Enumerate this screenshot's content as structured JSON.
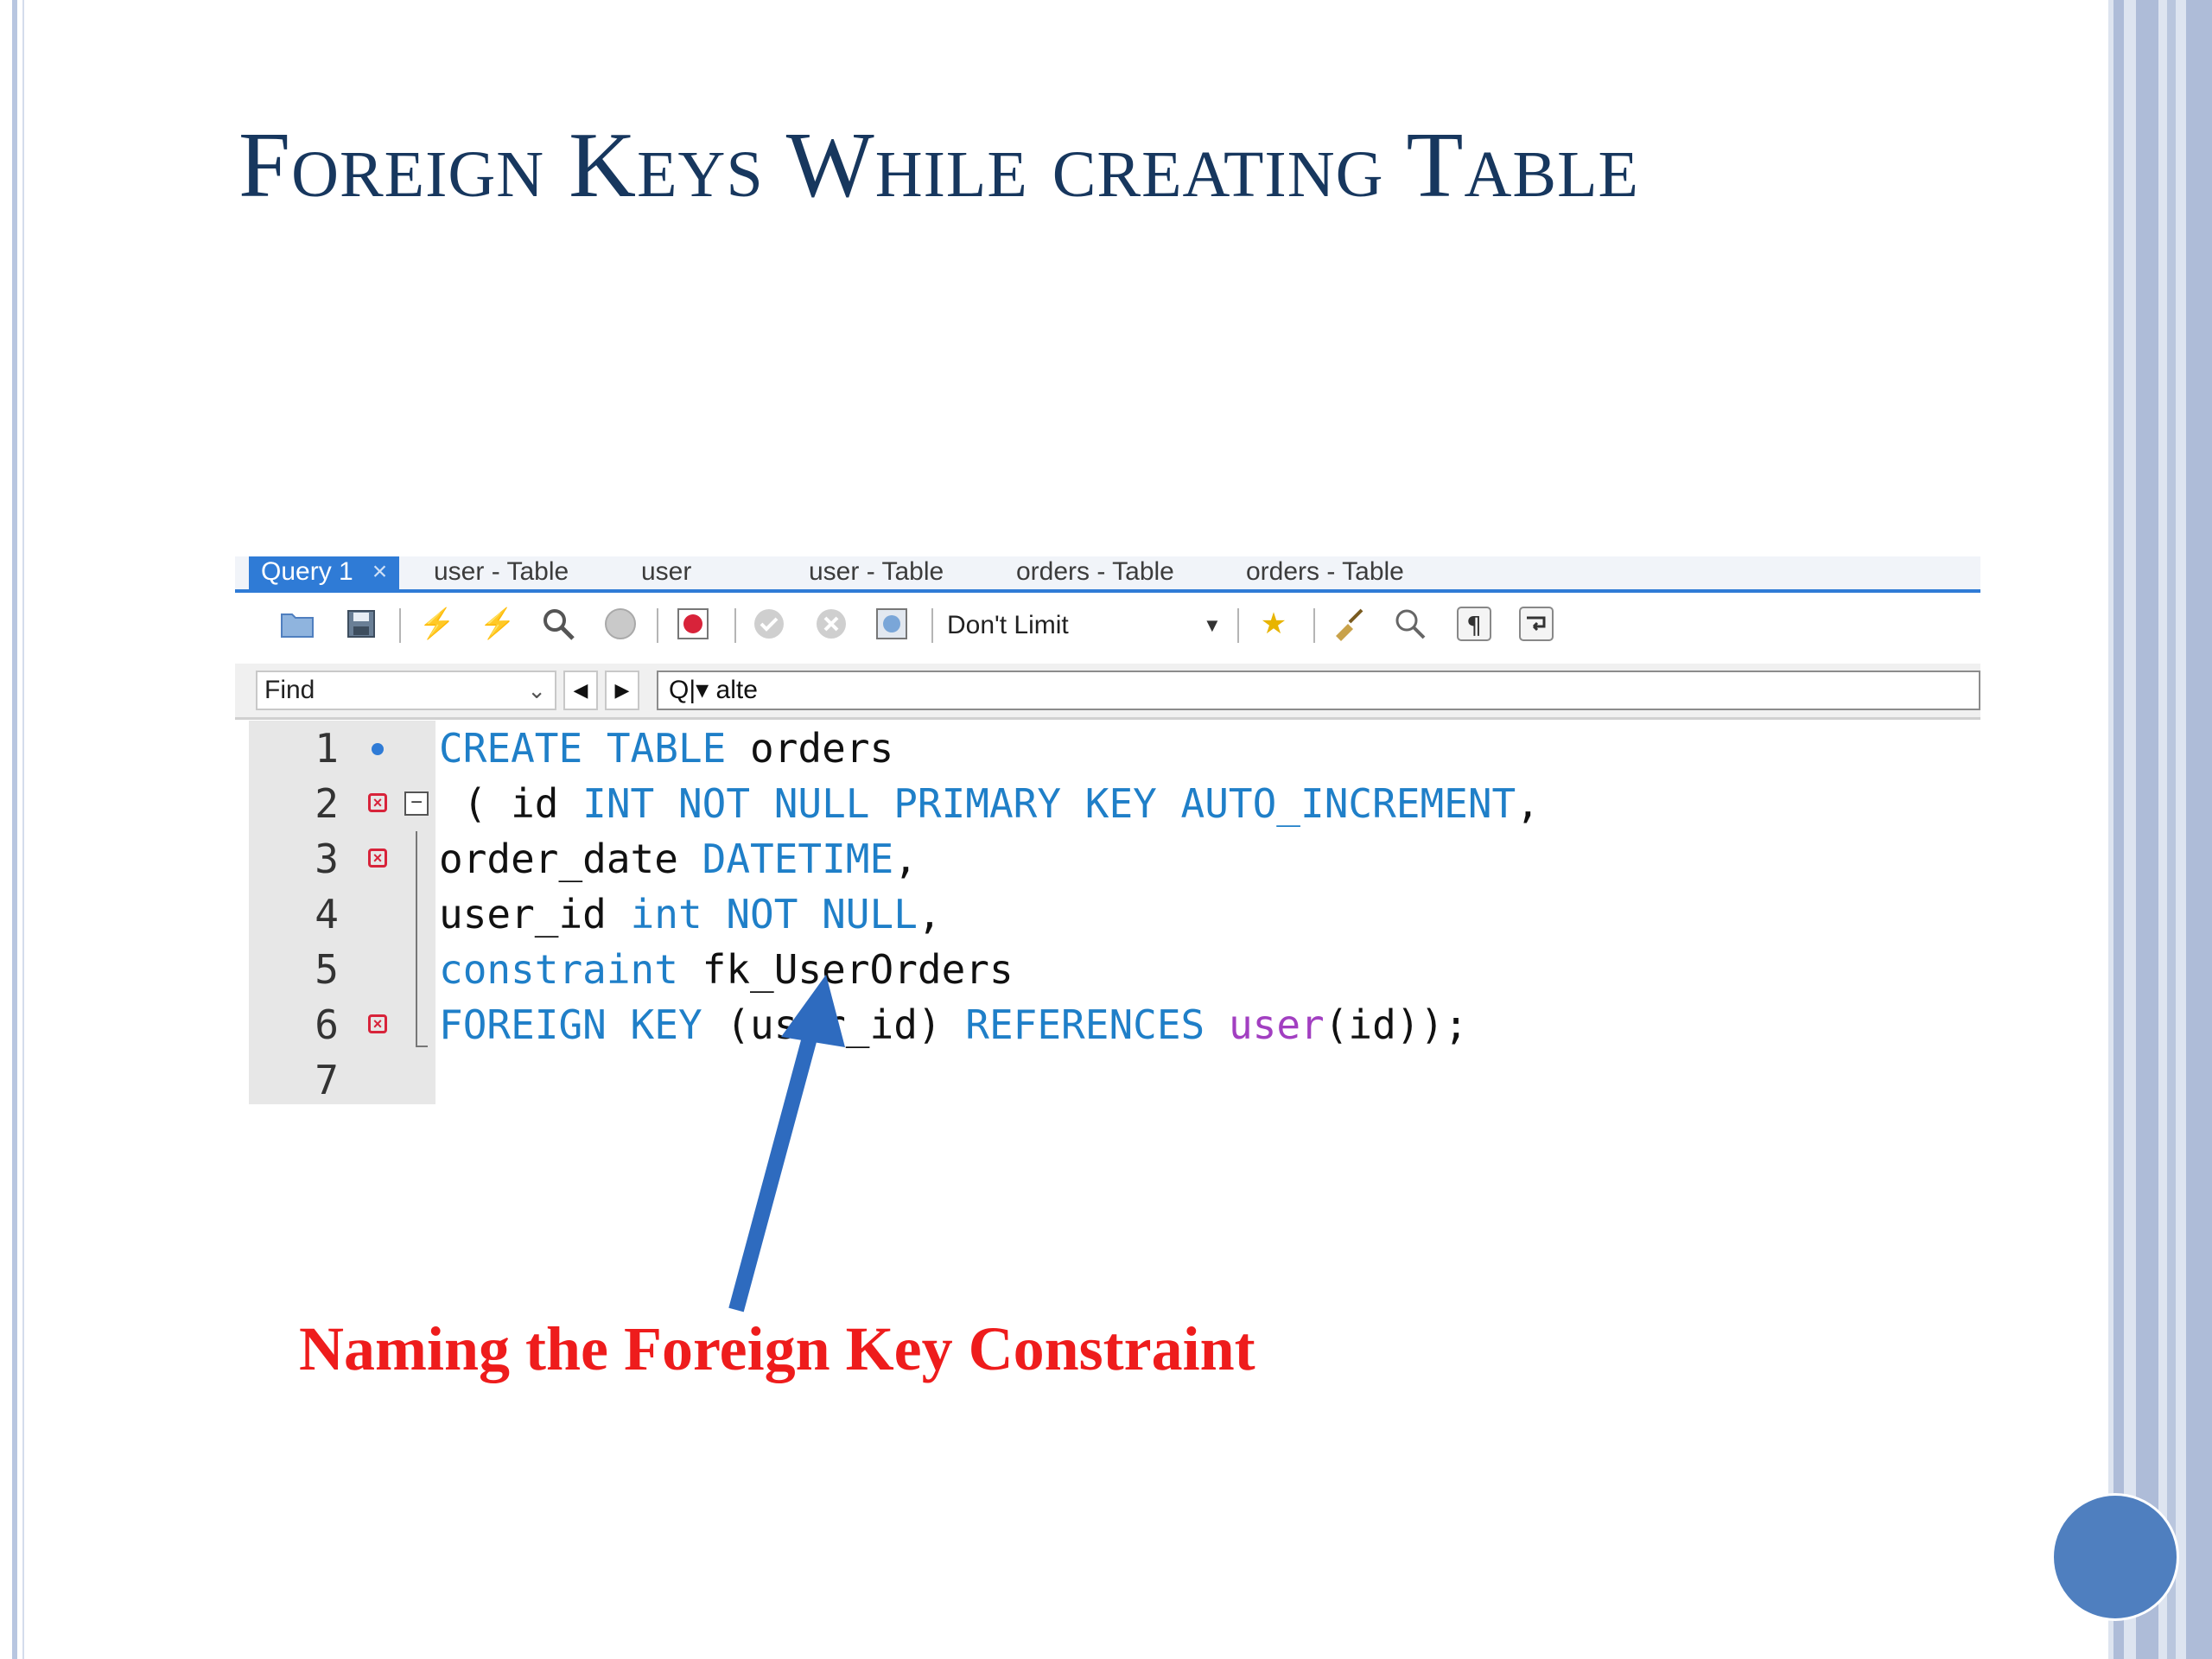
{
  "slide": {
    "title": "Foreign Keys While creating Table",
    "caption": "Naming the Foreign Key Constraint"
  },
  "editor": {
    "tabs": [
      {
        "label": "Query 1",
        "active": true,
        "close": "×"
      },
      {
        "label": "user - Table"
      },
      {
        "label": "user"
      },
      {
        "label": "user - Table"
      },
      {
        "label": "orders - Table"
      },
      {
        "label": "orders - Table"
      }
    ],
    "toolbar": {
      "limit_label": "Don't Limit",
      "icons": [
        "open-folder-icon",
        "save-icon",
        "execute-icon",
        "execute-current-icon",
        "explain-icon",
        "stop-icon",
        "toggle-error-icon",
        "commit-icon",
        "rollback-icon",
        "autocommit-icon",
        "bookmark-icon",
        "beautify-icon",
        "find-icon",
        "invisible-chars-icon",
        "word-wrap-icon"
      ]
    },
    "find": {
      "mode": "Find",
      "search_text": "alte",
      "search_prefix": "Q|▾"
    },
    "lines": [
      {
        "num": "1",
        "marker": "dot"
      },
      {
        "num": "2",
        "marker": "error"
      },
      {
        "num": "3",
        "marker": "error"
      },
      {
        "num": "4",
        "marker": ""
      },
      {
        "num": "5",
        "marker": ""
      },
      {
        "num": "6",
        "marker": "error"
      },
      {
        "num": "7",
        "marker": ""
      }
    ],
    "code": {
      "l1_kw": "CREATE TABLE",
      "l1_rest": " orders",
      "l2_a": " ( id ",
      "l2_kw": "INT NOT NULL PRIMARY KEY AUTO_INCREMENT",
      "l2_b": ",",
      "l3_a": "order_date ",
      "l3_kw": "DATETIME",
      "l3_b": ",",
      "l4_a": "user_id ",
      "l4_kw": "int NOT NULL",
      "l4_b": ",",
      "l5_kw": "constraint",
      "l5_b": " fk_UserOrders",
      "l6_kw1": "FOREIGN KEY",
      "l6_a": " (user_id) ",
      "l6_kw2": "REFERENCES",
      "l6_sp": " ",
      "l6_fn": "user",
      "l6_b": "(id));"
    }
  },
  "colors": {
    "title": "#17375e",
    "caption": "#ee1c1c",
    "keyword": "#1f7fc8",
    "function": "#a23fc1",
    "arrow": "#2e6bbf",
    "accent_circle": "#4f7fbf"
  }
}
